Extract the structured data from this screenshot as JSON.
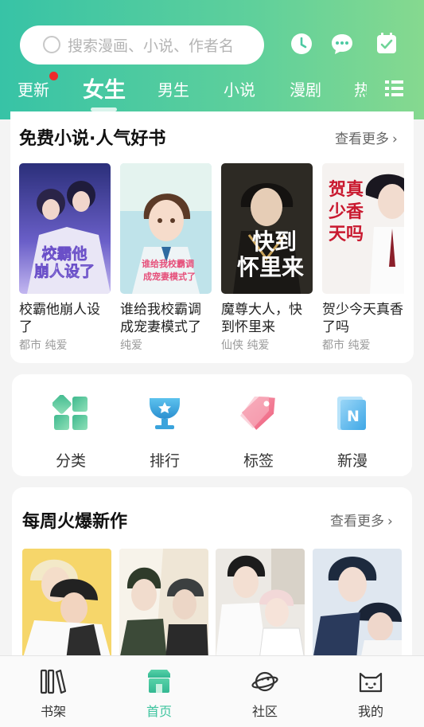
{
  "search": {
    "placeholder": "搜索漫画、小说、作者名"
  },
  "header_icons": [
    "clock-icon",
    "chat-bubble-icon",
    "checkin-icon"
  ],
  "tabs": [
    {
      "label": "更新",
      "has_dot": true
    },
    {
      "label": "女生",
      "active": true
    },
    {
      "label": "男生"
    },
    {
      "label": "小说"
    },
    {
      "label": "漫剧"
    },
    {
      "label": "热"
    }
  ],
  "free_novels": {
    "title": "免费小说·人气好书",
    "more": "查看更多",
    "books": [
      {
        "title": "校霸他崩人设了",
        "tags": "都市 纯爱",
        "cover_text": "校霸他崩人设了"
      },
      {
        "title": "谁给我校霸调成宠妻模式了",
        "tags": "纯爱",
        "cover_text": "谁给我校霸调成宠妻模式了"
      },
      {
        "title": "魔尊大人，快到怀里来",
        "tags": "仙侠 纯爱",
        "cover_text": "快到怀里来"
      },
      {
        "title": "贺少今天真香了吗",
        "tags": "都市 纯爱",
        "cover_text": "贺少今天真香了吗"
      }
    ]
  },
  "features": [
    {
      "label": "分类",
      "icon": "category-icon"
    },
    {
      "label": "排行",
      "icon": "trophy-icon"
    },
    {
      "label": "标签",
      "icon": "tag-icon"
    },
    {
      "label": "新漫",
      "icon": "new-comic-icon"
    }
  ],
  "weekly_hot": {
    "title": "每周火爆新作",
    "more": "查看更多"
  },
  "bottom_nav": [
    {
      "label": "书架",
      "icon": "bookshelf-icon"
    },
    {
      "label": "首页",
      "icon": "home-icon",
      "active": true
    },
    {
      "label": "社区",
      "icon": "planet-icon"
    },
    {
      "label": "我的",
      "icon": "cat-profile-icon"
    }
  ],
  "colors": {
    "accent": "#3ec49f",
    "header_start": "#37c3a6",
    "header_end": "#86d98f",
    "dot": "#ee2b2b"
  }
}
